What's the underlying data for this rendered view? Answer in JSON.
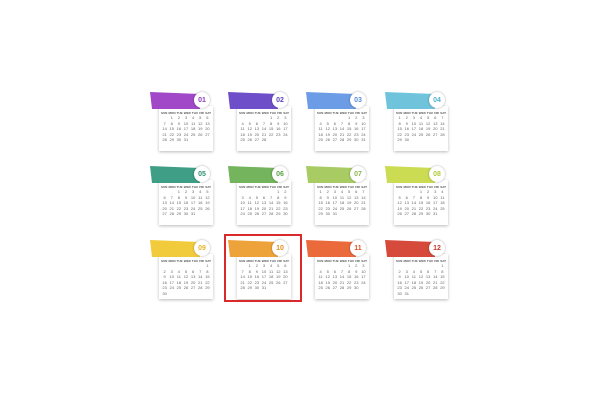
{
  "day_headers": [
    "SUN",
    "MON",
    "TUE",
    "WED",
    "THU",
    "FRI",
    "SAT"
  ],
  "months": [
    {
      "number": "01",
      "color": "#a048c8",
      "text_color": "#8a3cb8",
      "offset": 1,
      "days": 31
    },
    {
      "number": "02",
      "color": "#6f4fc9",
      "text_color": "#5b45b8",
      "offset": 4,
      "days": 28
    },
    {
      "number": "03",
      "color": "#6d9ce6",
      "text_color": "#5b8bd9",
      "offset": 4,
      "days": 31
    },
    {
      "number": "04",
      "color": "#6fc4db",
      "text_color": "#4fb0cd",
      "offset": 0,
      "days": 30
    },
    {
      "number": "05",
      "color": "#3f9f86",
      "text_color": "#2f8c73",
      "offset": 2,
      "days": 31
    },
    {
      "number": "06",
      "color": "#74b45d",
      "text_color": "#5ea04a",
      "offset": 5,
      "days": 30
    },
    {
      "number": "07",
      "color": "#a8cc63",
      "text_color": "#8fb84a",
      "offset": 0,
      "days": 31
    },
    {
      "number": "08",
      "color": "#cbdc52",
      "text_color": "#b5c83b",
      "offset": 3,
      "days": 31
    },
    {
      "number": "09",
      "color": "#f2cb3c",
      "text_color": "#e0b52a",
      "offset": 6,
      "days": 30
    },
    {
      "number": "10",
      "color": "#eea23a",
      "text_color": "#e08e22",
      "offset": 1,
      "days": 31
    },
    {
      "number": "11",
      "color": "#ea6a3c",
      "text_color": "#d8552a",
      "offset": 4,
      "days": 30
    },
    {
      "number": "12",
      "color": "#d64a3b",
      "text_color": "#c33a2c",
      "offset": 6,
      "days": 31
    }
  ]
}
